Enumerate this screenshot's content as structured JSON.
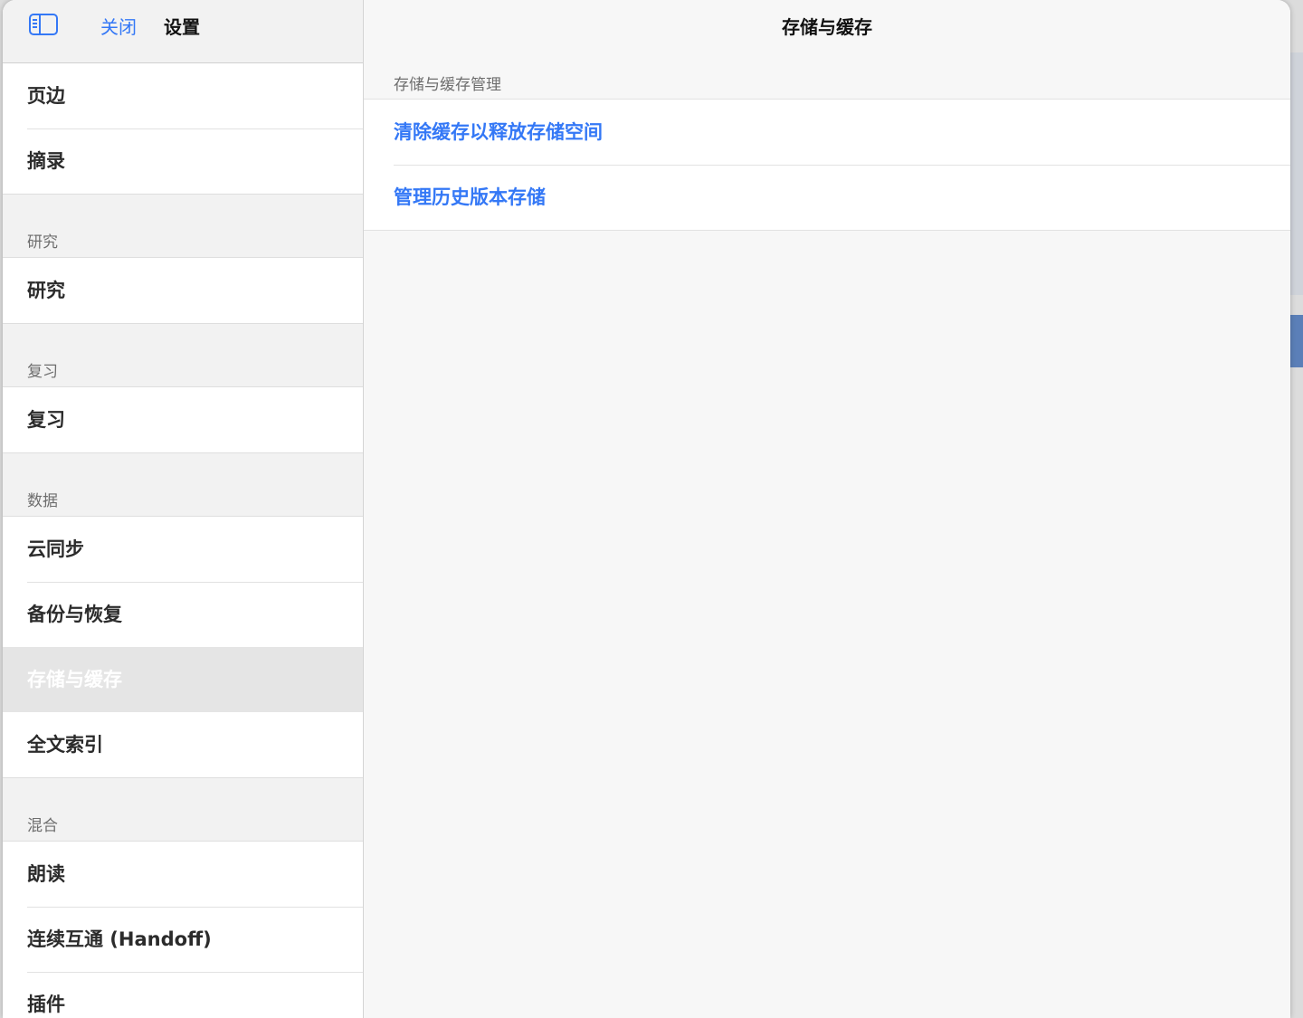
{
  "header": {
    "close_label": "关闭",
    "settings_title": "设置"
  },
  "sidebar": {
    "top_items": [
      {
        "label": "页边"
      },
      {
        "label": "摘录"
      }
    ],
    "sections": [
      {
        "header": "研究",
        "items": [
          {
            "label": "研究"
          }
        ]
      },
      {
        "header": "复习",
        "items": [
          {
            "label": "复习"
          }
        ]
      },
      {
        "header": "数据",
        "items": [
          {
            "label": "云同步"
          },
          {
            "label": "备份与恢复"
          },
          {
            "label": "存储与缓存",
            "selected": true
          },
          {
            "label": "全文索引"
          }
        ]
      },
      {
        "header": "混合",
        "items": [
          {
            "label": "朗读"
          },
          {
            "label": "连续互通 (Handoff)"
          },
          {
            "label": "插件"
          }
        ]
      }
    ]
  },
  "detail": {
    "title": "存储与缓存",
    "section_header": "存储与缓存管理",
    "actions": [
      {
        "label": "清除缓存以释放存储空间"
      },
      {
        "label": "管理历史版本存储"
      }
    ]
  },
  "colors": {
    "accent": "#3478f6",
    "selected_bg": "#e5e5e5"
  },
  "icons": {
    "sidebar_toggle": "sidebar-toggle-icon"
  }
}
